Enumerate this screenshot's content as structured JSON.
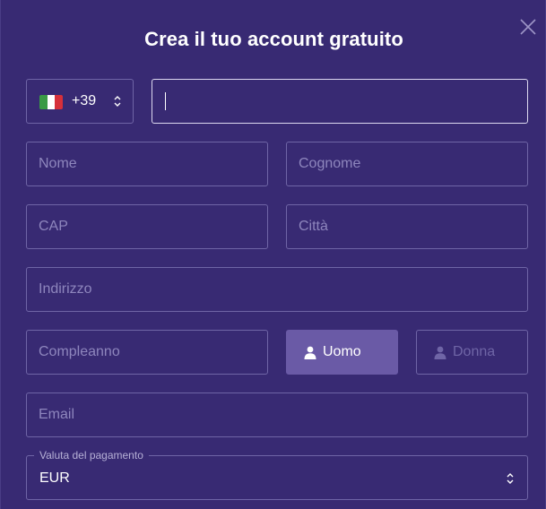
{
  "modal": {
    "title": "Crea il tuo account gratuito"
  },
  "phone": {
    "country_flag": "it-flag-icon",
    "prefix": "+39",
    "value": ""
  },
  "fields": {
    "first_name_placeholder": "Nome",
    "last_name_placeholder": "Cognome",
    "zip_placeholder": "CAP",
    "city_placeholder": "Città",
    "address_placeholder": "Indirizzo",
    "birthday_placeholder": "Compleanno",
    "email_placeholder": "Email"
  },
  "gender": {
    "male_label": "Uomo",
    "female_label": "Donna",
    "selected": "Uomo"
  },
  "currency": {
    "legend": "Valuta del pagamento",
    "value": "EUR"
  },
  "colors": {
    "background": "#382a73",
    "border": "#6f65a6",
    "selected_button": "#6a5aa6",
    "placeholder": "#8e86bd"
  }
}
